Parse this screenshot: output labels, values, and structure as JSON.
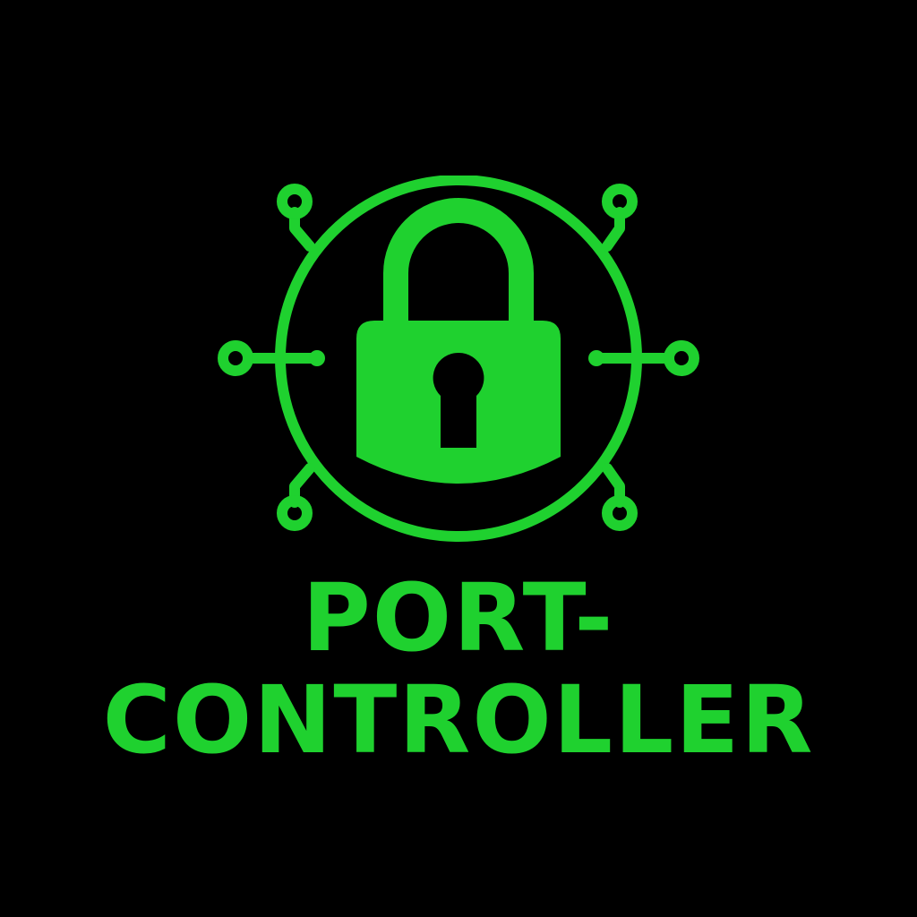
{
  "logo": {
    "brand_color": "#1fd12f",
    "background_color": "#000000",
    "icon": "padlock-circuit-icon",
    "wordmark_line_1": "PORT-",
    "wordmark_line_2": "CONTROLLER"
  }
}
